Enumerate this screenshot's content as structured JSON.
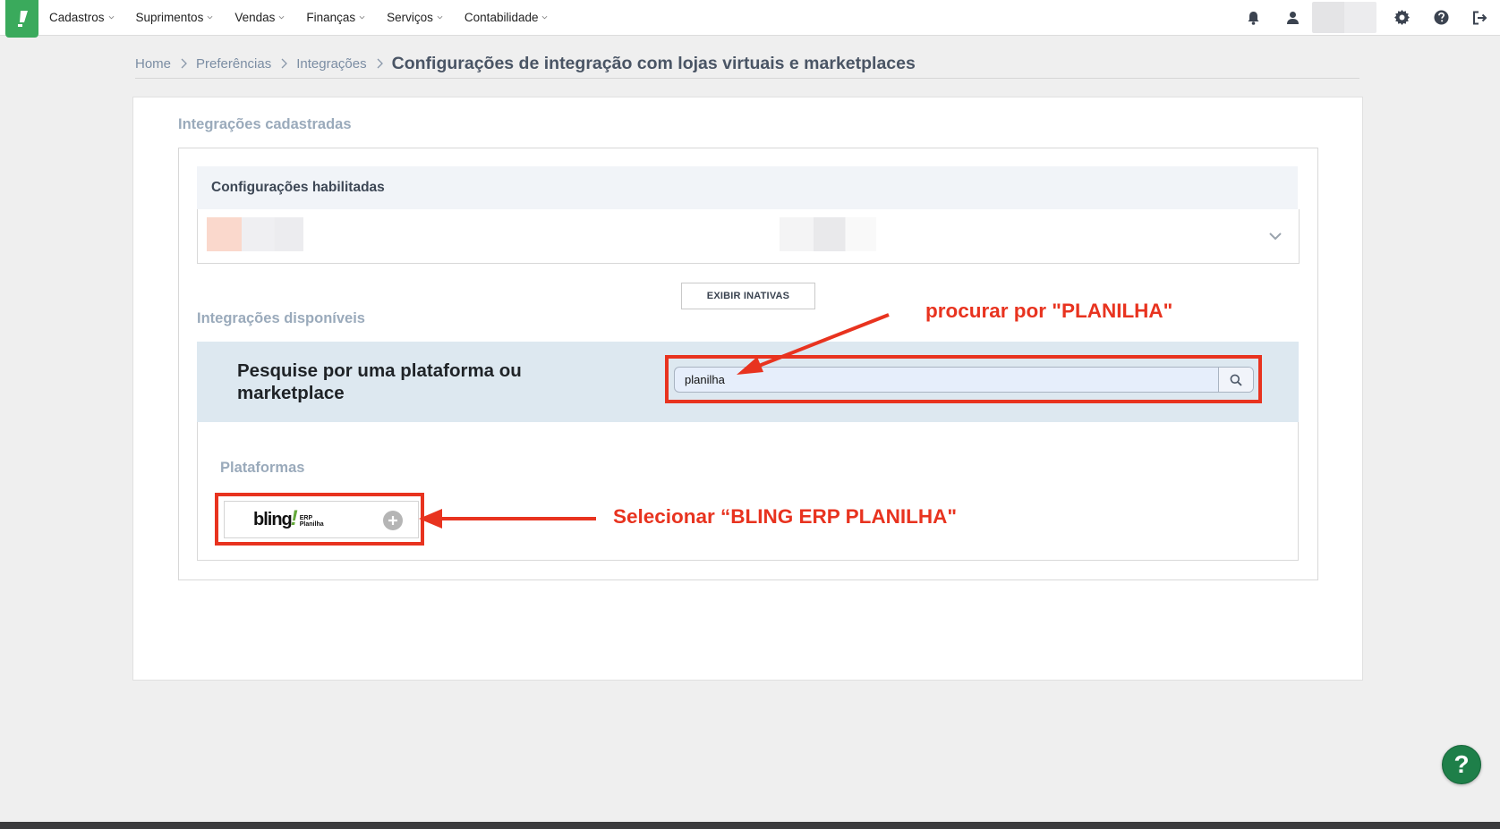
{
  "nav": {
    "menu": [
      {
        "label": "Cadastros"
      },
      {
        "label": "Suprimentos"
      },
      {
        "label": "Vendas"
      },
      {
        "label": "Finanças"
      },
      {
        "label": "Serviços"
      },
      {
        "label": "Contabilidade"
      }
    ],
    "icons": [
      "bell-icon",
      "user-icon",
      "gear-icon",
      "help-circle-icon",
      "logout-icon"
    ]
  },
  "breadcrumb": {
    "items": [
      "Home",
      "Preferências",
      "Integrações"
    ],
    "current": "Configurações de integração com lojas virtuais e marketplaces"
  },
  "registered": {
    "title": "Integrações cadastradas",
    "enabled_header": "Configurações habilitadas",
    "show_inactive_label": "EXIBIR INATIVAS"
  },
  "available": {
    "title": "Integrações disponíveis",
    "search_heading": "Pesquise por uma plataforma ou marketplace",
    "search_value": "planilha",
    "platforms_title": "Plataformas",
    "platform": {
      "logo_word": "bling",
      "logo_bang": "!",
      "logo_sub_1": "ERP",
      "logo_sub_2": "Planilha"
    }
  },
  "annotations": {
    "search_note": "procurar por \"PLANILHA\"",
    "select_note": "Selecionar “BLING ERP PLANILHA\""
  },
  "help": {
    "label": "?"
  },
  "colors": {
    "brand_green": "#3aaa5c",
    "annotation_red": "#e8331f",
    "help_green": "#1e7f49"
  }
}
